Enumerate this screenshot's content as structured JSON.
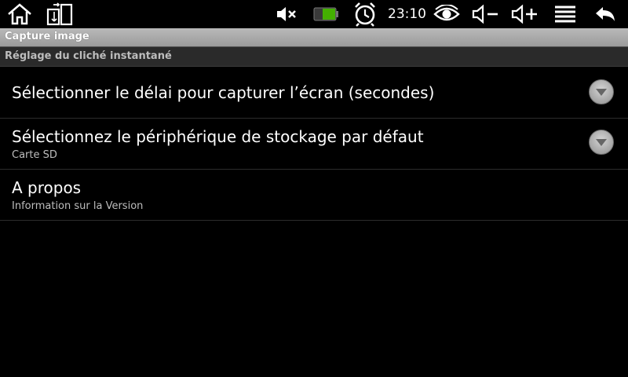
{
  "status_bar": {
    "time": "23:10",
    "icons": [
      "home-icon",
      "recent-apps-icon",
      "mute-icon",
      "battery-icon",
      "alarm-icon",
      "eye-icon",
      "volume-down-icon",
      "volume-up-icon",
      "menu-icon",
      "back-icon"
    ],
    "battery_color": "#44b000"
  },
  "app": {
    "title": "Capture image"
  },
  "section": {
    "header": "Réglage du cliché instantané"
  },
  "preferences": [
    {
      "title": "Sélectionner le délai pour capturer l’écran (secondes)",
      "summary": ""
    },
    {
      "title": "Sélectionnez le périphérique de stockage par défaut",
      "summary": "Carte SD"
    },
    {
      "title": "A propos",
      "summary": "Information sur la Version"
    }
  ]
}
